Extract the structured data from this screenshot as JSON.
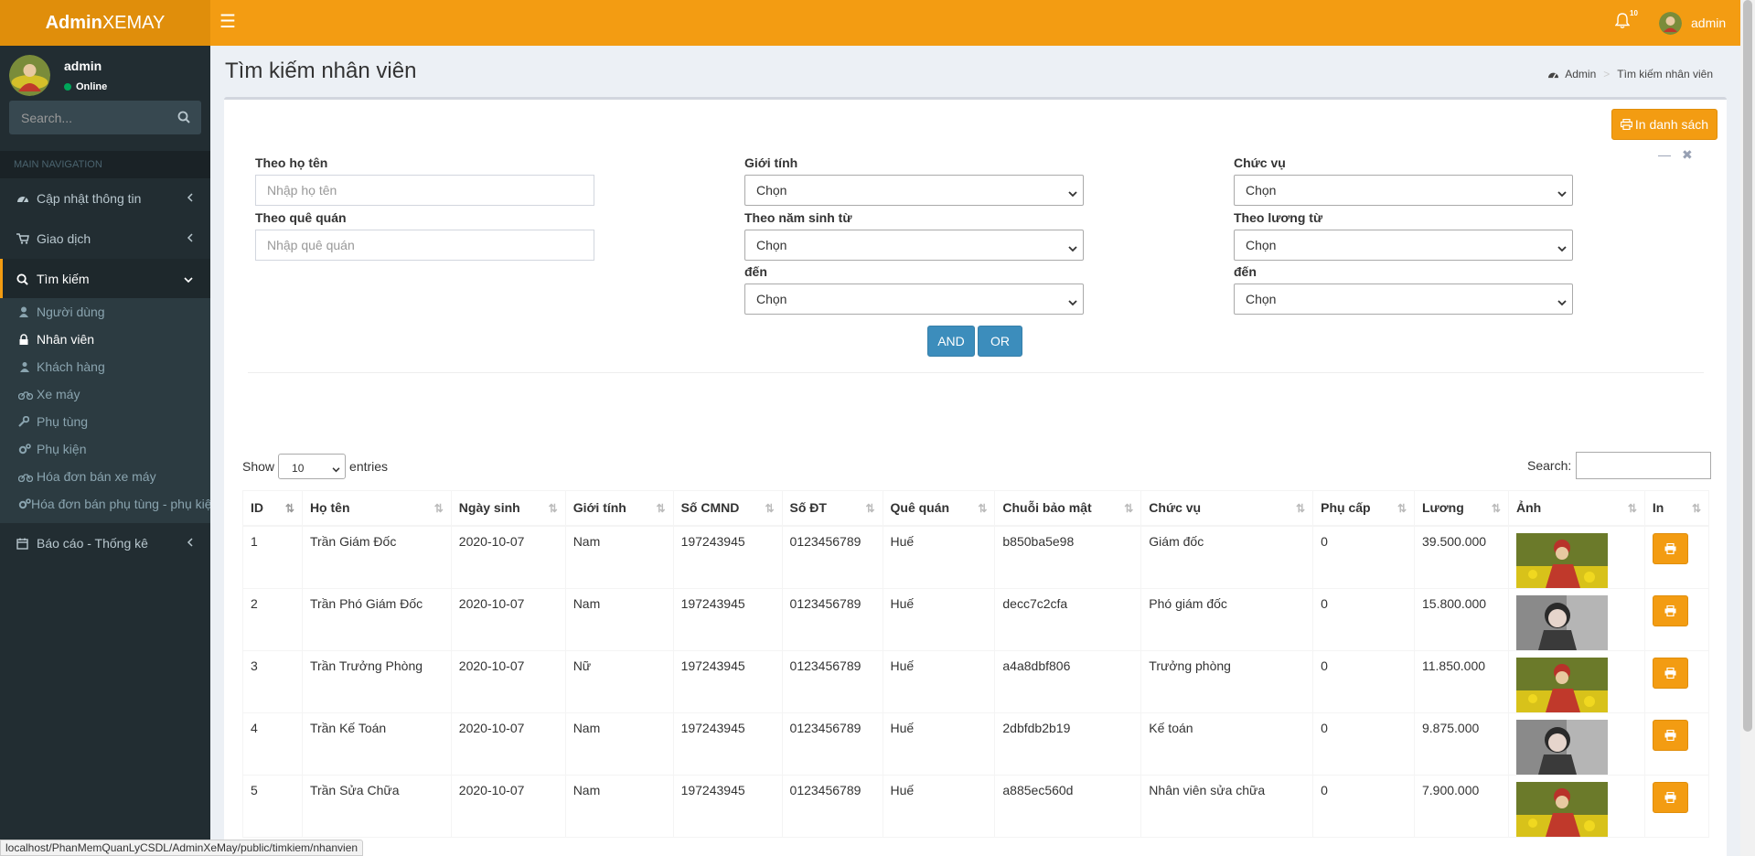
{
  "colors": {
    "accent": "#f39c12",
    "accent_dark": "#e08e0b",
    "sidebar": "#222d32",
    "primary": "#3c8dbc"
  },
  "header": {
    "logo_bold": "Admin",
    "logo_light": "XEMAY",
    "notif_count": "10",
    "username": "admin"
  },
  "sidebar": {
    "user_name": "admin",
    "user_status": "Online",
    "search_placeholder": "Search...",
    "nav_header": "MAIN NAVIGATION",
    "items": [
      {
        "label": "Cập nhật thông tin",
        "icon": "dashboard-icon"
      },
      {
        "label": "Giao dịch",
        "icon": "cart-icon"
      },
      {
        "label": "Tìm kiếm",
        "icon": "search-icon"
      },
      {
        "label": "Báo cáo - Thống kê",
        "icon": "calendar-icon"
      }
    ],
    "subitems": [
      {
        "label": "Người dùng",
        "icon": "user-icon"
      },
      {
        "label": "Nhân viên",
        "icon": "lock-icon"
      },
      {
        "label": "Khách hàng",
        "icon": "users-icon"
      },
      {
        "label": "Xe máy",
        "icon": "motorcycle-icon"
      },
      {
        "label": "Phụ tùng",
        "icon": "wrench-icon"
      },
      {
        "label": "Phụ kiện",
        "icon": "gears-icon"
      },
      {
        "label": "Hóa đơn bán xe máy",
        "icon": "motorcycle-icon"
      },
      {
        "label": "Hóa đơn bán phụ tùng - phụ kiện",
        "icon": "gears-icon"
      }
    ]
  },
  "page": {
    "title": "Tìm kiếm nhân viên",
    "breadcrumb_home": "Admin",
    "breadcrumb_current": "Tìm kiếm nhân viên"
  },
  "form": {
    "print_list": "In danh sách",
    "name_label": "Theo họ tên",
    "name_placeholder": "Nhập họ tên",
    "hometown_label": "Theo quê quán",
    "hometown_placeholder": "Nhập quê quán",
    "gender_label": "Giới tính",
    "gender_value": "Chọn",
    "birth_from_label": "Theo năm sinh từ",
    "birth_from_value": "Chọn",
    "birth_to_label": "đến",
    "birth_to_value": "Chọn",
    "position_label": "Chức vụ",
    "position_value": "Chọn",
    "salary_from_label": "Theo lương từ",
    "salary_from_value": "Chọn",
    "salary_to_label": "đến",
    "salary_to_value": "Chọn",
    "and_button": "AND",
    "or_button": "OR"
  },
  "datatable": {
    "show_label": "Show",
    "entries_value": "10",
    "entries_label": "entries",
    "search_label": "Search:",
    "columns": [
      "ID",
      "Họ tên",
      "Ngày sinh",
      "Giới tính",
      "Số CMND",
      "Số ĐT",
      "Quê quán",
      "Chuỗi bảo mật",
      "Chức vụ",
      "Phụ cấp",
      "Lương",
      "Ảnh",
      "In"
    ],
    "rows": [
      {
        "id": "1",
        "name": "Trần Giám Đốc",
        "dob": "2020-10-07",
        "gender": "Nam",
        "cmnd": "197243945",
        "phone": "0123456789",
        "hometown": "Huế",
        "secret": "b850ba5e98",
        "position": "Giám đốc",
        "allowance": "0",
        "salary": "39.500.000",
        "photo": "photo-a"
      },
      {
        "id": "2",
        "name": "Trần Phó Giám Đốc",
        "dob": "2020-10-07",
        "gender": "Nam",
        "cmnd": "197243945",
        "phone": "0123456789",
        "hometown": "Huế",
        "secret": "decc7c2cfa",
        "position": "Phó giám đốc",
        "allowance": "0",
        "salary": "15.800.000",
        "photo": "photo-b"
      },
      {
        "id": "3",
        "name": "Trần Trưởng Phòng",
        "dob": "2020-10-07",
        "gender": "Nữ",
        "cmnd": "197243945",
        "phone": "0123456789",
        "hometown": "Huế",
        "secret": "a4a8dbf806",
        "position": "Trưởng phòng",
        "allowance": "0",
        "salary": "11.850.000",
        "photo": "photo-a"
      },
      {
        "id": "4",
        "name": "Trần Kế Toán",
        "dob": "2020-10-07",
        "gender": "Nam",
        "cmnd": "197243945",
        "phone": "0123456789",
        "hometown": "Huế",
        "secret": "2dbfdb2b19",
        "position": "Kế toán",
        "allowance": "0",
        "salary": "9.875.000",
        "photo": "photo-b"
      },
      {
        "id": "5",
        "name": "Trần Sửa Chữa",
        "dob": "2020-10-07",
        "gender": "Nam",
        "cmnd": "197243945",
        "phone": "0123456789",
        "hometown": "Huế",
        "secret": "a885ec560d",
        "position": "Nhân viên sửa chữa",
        "allowance": "0",
        "salary": "7.900.000",
        "photo": "photo-a"
      }
    ]
  },
  "statusbar": {
    "url": "localhost/PhanMemQuanLyCSDL/AdminXeMay/public/timkiem/nhanvien"
  }
}
